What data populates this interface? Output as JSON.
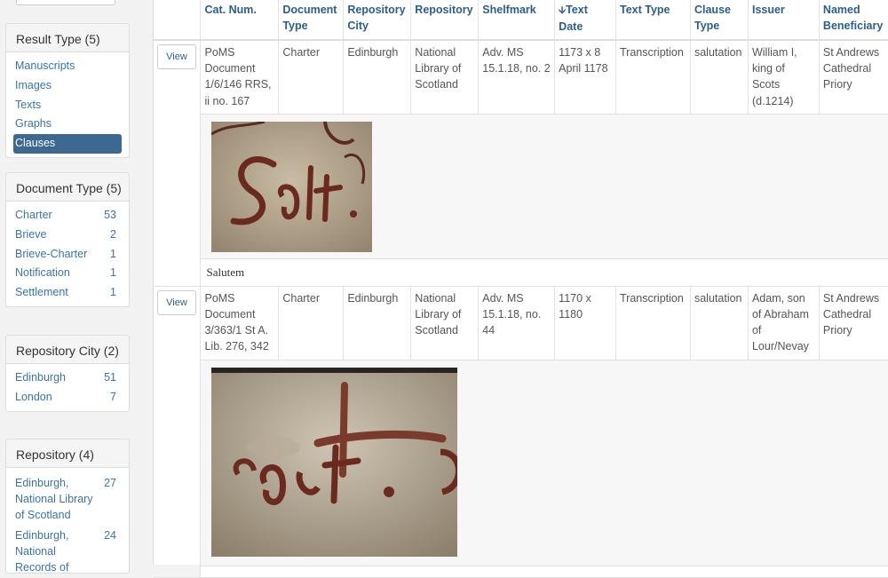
{
  "sidebar": {
    "facets": [
      {
        "title": "Result Type (5)",
        "items": [
          {
            "label": "Manuscripts",
            "count": ""
          },
          {
            "label": "Images",
            "count": ""
          },
          {
            "label": "Texts",
            "count": ""
          },
          {
            "label": "Graphs",
            "count": ""
          },
          {
            "label": "Clauses",
            "count": "",
            "active": true
          }
        ]
      },
      {
        "title": "Document Type (5)",
        "items": [
          {
            "label": "Charter",
            "count": "53"
          },
          {
            "label": "Brieve",
            "count": "2"
          },
          {
            "label": "Brieve-Charter",
            "count": "1"
          },
          {
            "label": "Notification",
            "count": "1"
          },
          {
            "label": "Settlement",
            "count": "1"
          }
        ]
      },
      {
        "title": "Repository City (2)",
        "items": [
          {
            "label": "Edinburgh",
            "count": "51"
          },
          {
            "label": "London",
            "count": "7"
          }
        ]
      },
      {
        "title": "Repository (4)",
        "items": [
          {
            "label": "Edinburgh, National Library of Scotland",
            "count": "27"
          },
          {
            "label": "Edinburgh, National Records of",
            "count": "24"
          }
        ]
      }
    ]
  },
  "table": {
    "headers": {
      "cat_num": "Cat. Num.",
      "document_type": "Document Type",
      "repository_city": "Repository City",
      "repository": "Repository",
      "shelfmark": "Shelfmark",
      "text_date": "Text Date",
      "text_type": "Text Type",
      "clause_type": "Clause Type",
      "issuer": "Issuer",
      "named_beneficiary": "Named Beneficiary"
    },
    "sort_arrow": "🡫",
    "view_label": "View",
    "rows": [
      {
        "cat_num": "PoMS Document 1/6/146 RRS, ii no. 167",
        "document_type": "Charter",
        "repository_city": "Edinburgh",
        "repository": "National Library of Scotland",
        "shelfmark": "Adv. MS 15.1.18, no. 2",
        "text_date": "1173 x 8 April 1178",
        "text_type": "Transcription",
        "clause_type": "salutation",
        "issuer": "William I, king of Scots (d.1214)",
        "named_beneficiary": "St Andrews Cathedral Priory",
        "caption": "Salutem"
      },
      {
        "cat_num": "PoMS Document 3/363/1 St A. Lib. 276, 342",
        "document_type": "Charter",
        "repository_city": "Edinburgh",
        "repository": "National Library of Scotland",
        "shelfmark": "Adv. MS 15.1.18, no. 44",
        "text_date": "1170 x 1180",
        "text_type": "Transcription",
        "clause_type": "salutation",
        "issuer": "Adam, son of Abraham of Lour/Nevay",
        "named_beneficiary": "St Andrews Cathedral Priory",
        "caption": ""
      }
    ]
  },
  "colors": {
    "link": "#2b5f8a",
    "active_bg": "#3d6891",
    "parchment": "#b8a98f",
    "ink": "#6b2a20"
  }
}
